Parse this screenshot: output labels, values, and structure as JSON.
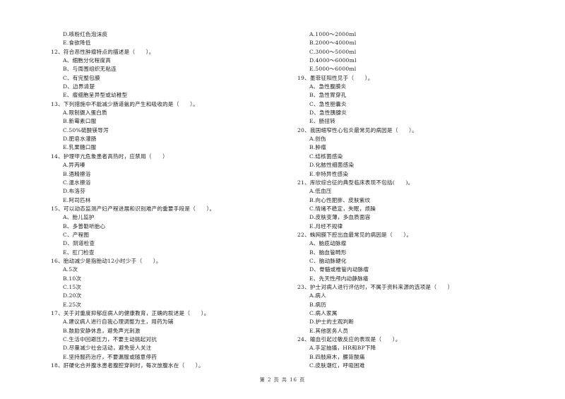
{
  "left_column": [
    {
      "type": "opt",
      "text": "D.咳粉红色泡沫痰"
    },
    {
      "type": "opt",
      "text": "E.食欲降低"
    },
    {
      "type": "q",
      "text": "12、符合恶性肿瘤特点的描述是（　　）。"
    },
    {
      "type": "opt",
      "text": "A、细胞分化程度高"
    },
    {
      "type": "opt",
      "text": "B、与周围组织无粘连"
    },
    {
      "type": "opt",
      "text": "C、有完整包膜"
    },
    {
      "type": "opt",
      "text": "D、边界清楚"
    },
    {
      "type": "opt",
      "text": "E、瘤细胞呈异型或幼稚型"
    },
    {
      "type": "q",
      "text": "13、下列措施中不能减少肠道氨的产生和吸收的是（　　）。"
    },
    {
      "type": "opt",
      "text": "A.限制摄入蛋白质"
    },
    {
      "type": "opt",
      "text": "B.新霉素口服"
    },
    {
      "type": "opt",
      "text": "C.50%硫酸镁导泻"
    },
    {
      "type": "opt",
      "text": "D.肥皂水灌肠"
    },
    {
      "type": "opt",
      "text": "E.乳果糖口服"
    },
    {
      "type": "q",
      "text": "14、护理甲亢危象患者高热时，应禁用（　　）"
    },
    {
      "type": "opt",
      "text": "A.异丙嗪"
    },
    {
      "type": "opt",
      "text": "B.酒精擦浴"
    },
    {
      "type": "opt",
      "text": "C.温水擦浴"
    },
    {
      "type": "opt",
      "text": "D.布洛芬"
    },
    {
      "type": "opt",
      "text": "E.阿司匹林"
    },
    {
      "type": "q",
      "text": "15、可以动态监测产妇产程进展和识别难产的重要手段是（　　）。"
    },
    {
      "type": "opt",
      "text": "A、胎儿监护"
    },
    {
      "type": "opt",
      "text": "B、多普勒听胎心"
    },
    {
      "type": "opt",
      "text": "C、产程图"
    },
    {
      "type": "opt",
      "text": "D、阴道检查"
    },
    {
      "type": "opt",
      "text": "E、肛门检查"
    },
    {
      "type": "q",
      "text": "16、胎动减少是指胎动12小时少于（　　）。"
    },
    {
      "type": "opt",
      "text": "A.5次"
    },
    {
      "type": "opt",
      "text": "B.10次"
    },
    {
      "type": "opt",
      "text": "C.15次"
    },
    {
      "type": "opt",
      "text": "D.20次"
    },
    {
      "type": "opt",
      "text": "E.25次"
    },
    {
      "type": "q",
      "text": "17、关于对重度抑郁症病人的健康教育，正确的叙述是（　　）。"
    },
    {
      "type": "opt",
      "text": "A.建议病人进行自我心理调整为主，用药为辅"
    },
    {
      "type": "opt",
      "text": "B.鼓励安静休息，避免声光刺激"
    },
    {
      "type": "opt",
      "text": "C.生活中回避压力，不要主动挑起对抗"
    },
    {
      "type": "opt",
      "text": "D.尽量减少社会活动，避免受人关注"
    },
    {
      "type": "opt",
      "text": "E.坚持服药治疗，不要漏服或随意停药"
    },
    {
      "type": "q",
      "text": "18、肝硬化合并腹水患者腹腔穿刺时，每次放腹水在（　　）。"
    }
  ],
  "right_column": [
    {
      "type": "opt",
      "text": "A.1000～2000ml"
    },
    {
      "type": "opt",
      "text": "B.2000～4000ml"
    },
    {
      "type": "opt",
      "text": "C.3000～5000ml"
    },
    {
      "type": "opt",
      "text": "D.4000～6000ml"
    },
    {
      "type": "opt",
      "text": "E.5000～6000ml"
    },
    {
      "type": "q",
      "text": "19、墨菲征阳性见于（　　）。"
    },
    {
      "type": "opt",
      "text": "A、急性腹膜炎"
    },
    {
      "type": "opt",
      "text": "B、急性胃穿孔"
    },
    {
      "type": "opt",
      "text": "C、急性胆囊炎"
    },
    {
      "type": "opt",
      "text": "D、急性胰腺炎"
    },
    {
      "type": "opt",
      "text": "E、肠扭转"
    },
    {
      "type": "q",
      "text": "20、我国缩窄性心包炎最常见的病因是（　　）。"
    },
    {
      "type": "opt",
      "text": "A.创伤"
    },
    {
      "type": "opt",
      "text": "B.肿瘤"
    },
    {
      "type": "opt",
      "text": "C.结核菌感染"
    },
    {
      "type": "opt",
      "text": "D.化脓性细菌感染"
    },
    {
      "type": "opt",
      "text": "E.非特异性感染"
    },
    {
      "type": "q",
      "text": "21、库欣综合征的典型临床表现不包括(　　)。"
    },
    {
      "type": "opt",
      "text": "A.低血压"
    },
    {
      "type": "opt",
      "text": "B.向心性肥胖、皮肤紫纹"
    },
    {
      "type": "opt",
      "text": "C.情绪不稳定，失眠，烦躁"
    },
    {
      "type": "opt",
      "text": "D.皮肤变薄，多血质面容"
    },
    {
      "type": "opt",
      "text": "E.月经不规律"
    },
    {
      "type": "q",
      "text": "22、蛛网膜下腔出血最常见的病因是（　　）。"
    },
    {
      "type": "opt",
      "text": "A、脑底动脉瘤"
    },
    {
      "type": "opt",
      "text": "B、脑血管畸形"
    },
    {
      "type": "opt",
      "text": "C、脑动脉硬化"
    },
    {
      "type": "opt",
      "text": "D、脊髓或椎管内动脉瘤"
    },
    {
      "type": "opt",
      "text": "E、先天性颅内动静脉瘘"
    },
    {
      "type": "q",
      "text": "23、护士对病人进行评估时，不属于资料来源的选项是（　　）"
    },
    {
      "type": "opt",
      "text": "A.病人"
    },
    {
      "type": "opt",
      "text": "B.病历"
    },
    {
      "type": "opt",
      "text": "C.病人家属"
    },
    {
      "type": "opt",
      "text": "D.护士的主观判断"
    },
    {
      "type": "opt",
      "text": "E.其他医务人员"
    },
    {
      "type": "q",
      "text": "24、输血引起过敏反应的表现是（　　）。"
    },
    {
      "type": "opt",
      "text": "A.手足抽搐，HR和BP下降"
    },
    {
      "type": "opt",
      "text": "B.四肢麻木，腰背酸痛"
    },
    {
      "type": "opt",
      "text": "C.皮肤潮红，呼吸困难"
    }
  ],
  "footer": {
    "page_label": "第 2 页 共 16 页"
  }
}
